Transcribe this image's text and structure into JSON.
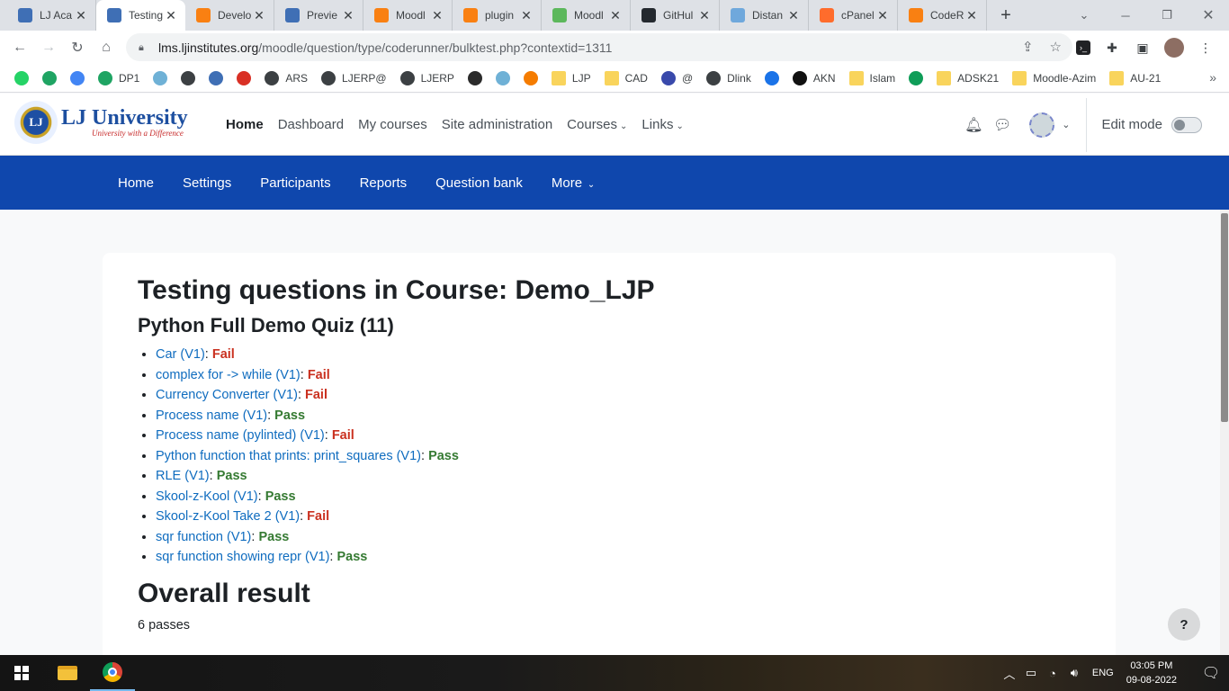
{
  "browser": {
    "tabs": [
      {
        "title": "LJ Aca",
        "icon_color": "#3f6fb5",
        "icon": "lj-shield-icon",
        "active": false
      },
      {
        "title": "Testing",
        "icon_color": "#3f6fb5",
        "icon": "lj-shield-icon",
        "active": true
      },
      {
        "title": "Develo",
        "icon_color": "#f98012",
        "icon": "moodle-icon",
        "active": false
      },
      {
        "title": "Previe",
        "icon_color": "#3f6fb5",
        "icon": "lj-shield-icon",
        "active": false
      },
      {
        "title": "Moodl",
        "icon_color": "#f98012",
        "icon": "moodle-icon",
        "active": false
      },
      {
        "title": "plugin",
        "icon_color": "#f98012",
        "icon": "moodle-icon",
        "active": false
      },
      {
        "title": "Moodl",
        "icon_color": "#5cb85c",
        "icon": "moodle-green-icon",
        "active": false
      },
      {
        "title": "GitHul",
        "icon_color": "#24292f",
        "icon": "github-icon",
        "active": false
      },
      {
        "title": "Distan",
        "icon_color": "#6fa8dc",
        "icon": "shield-icon",
        "active": false
      },
      {
        "title": "cPanel",
        "icon_color": "#ff6c2c",
        "icon": "cpanel-icon",
        "active": false
      },
      {
        "title": "CodeR",
        "icon_color": "#f98012",
        "icon": "moodle-icon",
        "active": false
      }
    ],
    "url_host": "lms.ljinstitutes.org",
    "url_path": "/moodle/question/type/coderunner/bulktest.php?contextid=1311",
    "bookmarks": [
      {
        "label": "",
        "color": "#25d366",
        "icon": "whatsapp-icon",
        "folder": false
      },
      {
        "label": "",
        "color": "#1fa463",
        "icon": "google-drive-icon",
        "folder": false
      },
      {
        "label": "",
        "color": "#4285f4",
        "icon": "google-icon",
        "folder": false
      },
      {
        "label": "DP1",
        "color": "#1fa463",
        "icon": "google-drive-icon",
        "folder": false
      },
      {
        "label": "",
        "color": "#6fb1d6",
        "icon": "globe-icon",
        "folder": false
      },
      {
        "label": "",
        "color": "#3c4043",
        "icon": "globe-icon",
        "folder": false
      },
      {
        "label": "",
        "color": "#3f6fb5",
        "icon": "lj-shield-icon",
        "folder": false
      },
      {
        "label": "",
        "color": "#d93025",
        "icon": "pdf-icon",
        "folder": false
      },
      {
        "label": "ARS",
        "color": "#3c4043",
        "icon": "globe-icon",
        "folder": false
      },
      {
        "label": "LJERP@",
        "color": "#3c4043",
        "icon": "globe-icon",
        "folder": false
      },
      {
        "label": "LJERP",
        "color": "#3c4043",
        "icon": "globe-icon",
        "folder": false
      },
      {
        "label": "",
        "color": "#2b2b2b",
        "icon": "bulb-icon",
        "folder": false
      },
      {
        "label": "",
        "color": "#6fb1d6",
        "icon": "globe-icon",
        "folder": false
      },
      {
        "label": "",
        "color": "#f57c00",
        "icon": "swift-icon",
        "folder": false
      },
      {
        "label": "LJP",
        "color": "#f9d45c",
        "icon": "folder-icon",
        "folder": true
      },
      {
        "label": "CAD",
        "color": "#f9d45c",
        "icon": "folder-icon",
        "folder": true
      },
      {
        "label": "@",
        "color": "#3949ab",
        "icon": "calendar-icon",
        "folder": false
      },
      {
        "label": "Dlink",
        "color": "#3c4043",
        "icon": "globe-icon",
        "folder": false
      },
      {
        "label": "",
        "color": "#1a73e8",
        "icon": "download-icon",
        "folder": false
      },
      {
        "label": "AKN",
        "color": "#111111",
        "icon": "arrow-icon",
        "folder": false
      },
      {
        "label": "Islam",
        "color": "#f9d45c",
        "icon": "folder-icon",
        "folder": true
      },
      {
        "label": "",
        "color": "#0f9d58",
        "icon": "meet-icon",
        "folder": false
      },
      {
        "label": "ADSK21",
        "color": "#f9d45c",
        "icon": "folder-icon",
        "folder": true
      },
      {
        "label": "Moodle-Azim",
        "color": "#f9d45c",
        "icon": "folder-icon",
        "folder": true
      },
      {
        "label": "AU-21",
        "color": "#f9d45c",
        "icon": "folder-icon",
        "folder": true
      }
    ]
  },
  "moodle": {
    "brand_name": "LJ University",
    "brand_tagline": "University with a Difference",
    "brand_seal": "LJ",
    "primary_nav": [
      {
        "label": "Home",
        "active": true,
        "dropdown": false
      },
      {
        "label": "Dashboard",
        "active": false,
        "dropdown": false
      },
      {
        "label": "My courses",
        "active": false,
        "dropdown": false
      },
      {
        "label": "Site administration",
        "active": false,
        "dropdown": false
      },
      {
        "label": "Courses",
        "active": false,
        "dropdown": true
      },
      {
        "label": "Links",
        "active": false,
        "dropdown": true
      }
    ],
    "edit_mode_label": "Edit mode",
    "secondary_nav": [
      {
        "label": "Home",
        "dropdown": false
      },
      {
        "label": "Settings",
        "dropdown": false
      },
      {
        "label": "Participants",
        "dropdown": false
      },
      {
        "label": "Reports",
        "dropdown": false
      },
      {
        "label": "Question bank",
        "dropdown": false
      },
      {
        "label": "More",
        "dropdown": true
      }
    ],
    "secondary_nav_color": "#0f47ad"
  },
  "page": {
    "title": "Testing questions in Course: Demo_LJP",
    "quiz_heading": "Python Full Demo Quiz (11)",
    "results": [
      {
        "question": "Car (V1)",
        "status": "Fail"
      },
      {
        "question": "complex for -> while (V1)",
        "status": "Fail"
      },
      {
        "question": "Currency Converter (V1)",
        "status": "Fail"
      },
      {
        "question": "Process name (V1)",
        "status": "Pass"
      },
      {
        "question": "Process name (pylinted) (V1)",
        "status": "Fail"
      },
      {
        "question": "Python function that prints: print_squares (V1)",
        "status": "Pass"
      },
      {
        "question": "RLE (V1)",
        "status": "Pass"
      },
      {
        "question": "Skool-z-Kool (V1)",
        "status": "Pass"
      },
      {
        "question": "Skool-z-Kool Take 2 (V1)",
        "status": "Fail"
      },
      {
        "question": "sqr function (V1)",
        "status": "Pass"
      },
      {
        "question": "sqr function showing repr (V1)",
        "status": "Pass"
      }
    ],
    "overall_heading": "Overall result",
    "overall_summary": "6 passes",
    "help_label": "?",
    "pass_color": "#357a32",
    "fail_color": "#ca3120"
  },
  "taskbar": {
    "language": "ENG",
    "time": "03:05 PM",
    "date": "09-08-2022"
  }
}
